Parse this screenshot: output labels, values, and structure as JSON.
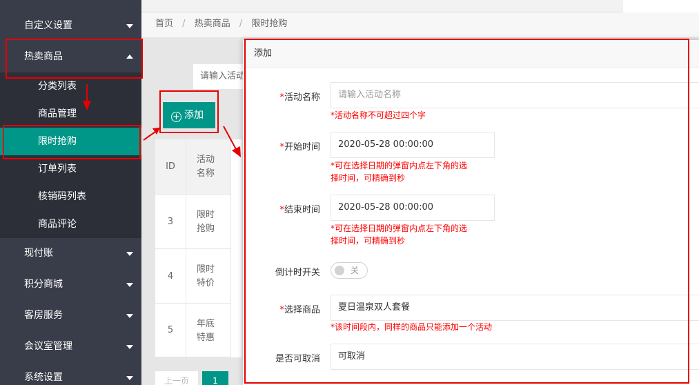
{
  "sidebar": {
    "items": [
      {
        "label": "自定义设置"
      },
      {
        "label": "热卖商品"
      },
      {
        "label": "现付账"
      },
      {
        "label": "积分商城"
      },
      {
        "label": "客房服务"
      },
      {
        "label": "会议室管理"
      },
      {
        "label": "系统设置"
      }
    ],
    "subitems": [
      {
        "label": "分类列表"
      },
      {
        "label": "商品管理"
      },
      {
        "label": "限时抢购"
      },
      {
        "label": "订单列表"
      },
      {
        "label": "核销码列表"
      },
      {
        "label": "商品评论"
      }
    ]
  },
  "breadcrumb": {
    "home": "首页",
    "section": "热卖商品",
    "current": "限时抢购",
    "separator": "/"
  },
  "toolbar": {
    "search_placeholder": "请输入活动",
    "add_label": "添加",
    "add_icon": "plus-circle-icon"
  },
  "table": {
    "headers": [
      "ID",
      "活动\n名称"
    ],
    "rows": [
      {
        "id": "3",
        "name": "限时\n抢购"
      },
      {
        "id": "4",
        "name": "限时\n特价"
      },
      {
        "id": "5",
        "name": "年底\n特惠"
      }
    ]
  },
  "pager": {
    "prev": "上一页",
    "page": "1"
  },
  "modal": {
    "title": "添加",
    "required_mark": "*",
    "fields": {
      "name": {
        "label": "活动名称",
        "placeholder": "请输入活动名称",
        "hint": "*活动名称不可超过四个字"
      },
      "start": {
        "label": "开始时间",
        "value": "2020-05-28 00:00:00",
        "hint1": "*可在选择日期的弹窗内点左下角的选",
        "hint2": "择时间，可精确到秒"
      },
      "end": {
        "label": "结束时间",
        "value": "2020-05-28 00:00:00",
        "hint1": "*可在选择日期的弹窗内点左下角的选",
        "hint2": "择时间，可精确到秒"
      },
      "countdown": {
        "label": "倒计时开关",
        "state": "关"
      },
      "product": {
        "label": "选择商品",
        "value": "夏日温泉双人套餐",
        "hint": "*该时间段内，同样的商品只能添加一个活动"
      },
      "cancel": {
        "label": "是否可取消",
        "value": "可取消"
      }
    }
  },
  "colors": {
    "accent": "#009688",
    "sidebar": "#393d49",
    "annotation": "#e60000",
    "hint": "#ff0000"
  }
}
